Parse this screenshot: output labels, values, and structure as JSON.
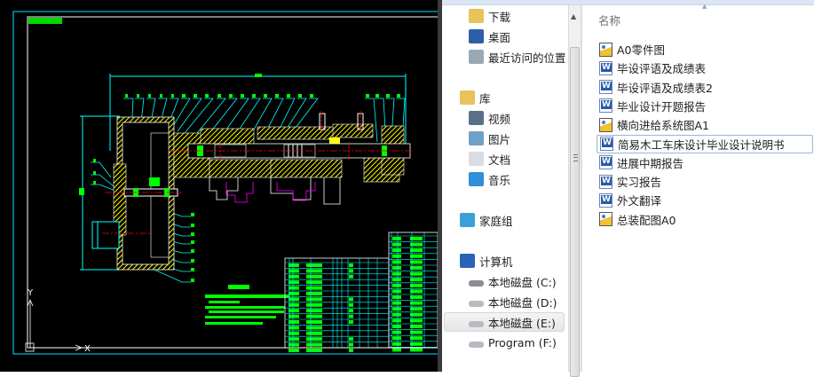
{
  "cad": {
    "background": "#000000",
    "colors": {
      "frame_outer": "#00e5ff",
      "frame_inner": "#ffffff",
      "hatch": "#ffff00",
      "text": "#00ff00",
      "center": "#ff0000",
      "leader": "#00ffff",
      "aux": "#ff00ff"
    },
    "ucs": {
      "y_label": "Y",
      "x_label": "X"
    }
  },
  "explorer": {
    "nav": {
      "items": [
        {
          "label": "下载",
          "icon": "downloads-folder-icon"
        },
        {
          "label": "桌面",
          "icon": "desktop-icon"
        },
        {
          "label": "最近访问的位置",
          "icon": "recent-places-icon"
        },
        {
          "label": "库",
          "icon": "library-icon"
        },
        {
          "label": "视频",
          "icon": "video-icon"
        },
        {
          "label": "图片",
          "icon": "pictures-icon"
        },
        {
          "label": "文档",
          "icon": "documents-icon"
        },
        {
          "label": "音乐",
          "icon": "music-icon"
        },
        {
          "label": "家庭组",
          "icon": "homegroup-icon"
        },
        {
          "label": "计算机",
          "icon": "computer-icon"
        },
        {
          "label": "本地磁盘 (C:)",
          "icon": "system-drive-icon"
        },
        {
          "label": "本地磁盘 (D:)",
          "icon": "drive-icon"
        },
        {
          "label": "本地磁盘 (E:)",
          "icon": "drive-icon",
          "selected": true
        },
        {
          "label": "Program (F:)",
          "icon": "drive-icon"
        }
      ]
    },
    "list": {
      "column_header": "名称",
      "sort": "ascending",
      "files": [
        {
          "name": "A0零件图",
          "type": "dwg"
        },
        {
          "name": "毕设评语及成绩表",
          "type": "word"
        },
        {
          "name": "毕设评语及成绩表2",
          "type": "word"
        },
        {
          "name": "毕业设计开题报告",
          "type": "word"
        },
        {
          "name": "横向进给系统图A1",
          "type": "dwg"
        },
        {
          "name": "简易木工车床设计毕业设计说明书",
          "type": "word",
          "focused": true
        },
        {
          "name": "进展中期报告",
          "type": "word"
        },
        {
          "name": "实习报告",
          "type": "word"
        },
        {
          "name": "外文翻译",
          "type": "word"
        },
        {
          "name": "总装配图A0",
          "type": "dwg"
        }
      ]
    }
  }
}
